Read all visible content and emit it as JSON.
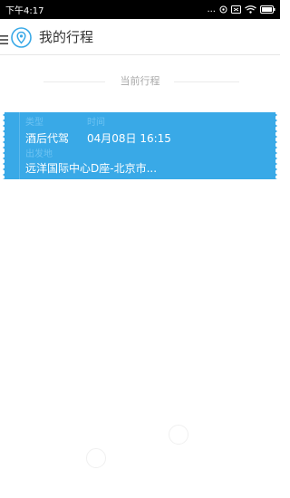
{
  "status_bar": {
    "time": "下午4:17",
    "dots": "...",
    "icons": [
      "location-icon",
      "sim-icon",
      "wifi-icon",
      "battery-icon"
    ]
  },
  "header": {
    "title": "我的行程",
    "icons": [
      "menu-icon",
      "location-pin-logo-icon"
    ]
  },
  "section": {
    "label": "当前行程"
  },
  "trip": {
    "type_label": "类型",
    "type_value": "酒后代驾",
    "time_label": "时间",
    "time_value": "04月08日 16:15",
    "departure_label": "出发地",
    "departure_value": "远洋国际中心D座-北京市..."
  },
  "colors": {
    "status_bar": "#000000",
    "card": "#39a9e7",
    "card_label": "#6dc3f2",
    "logo": "#39a9e7",
    "title": "#333333",
    "section_label": "#a9a9a9"
  }
}
